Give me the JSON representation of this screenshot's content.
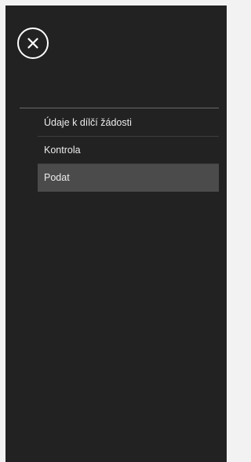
{
  "close_button": {
    "icon": "close-icon",
    "color": "#ffffff"
  },
  "menu": {
    "items": [
      {
        "label": "Údaje k dílčí žádosti",
        "active": false
      },
      {
        "label": "Kontrola",
        "active": false
      },
      {
        "label": "Podat",
        "active": true
      }
    ]
  },
  "colors": {
    "panel_background": "#222222",
    "active_item_background": "#4b4b4b"
  }
}
